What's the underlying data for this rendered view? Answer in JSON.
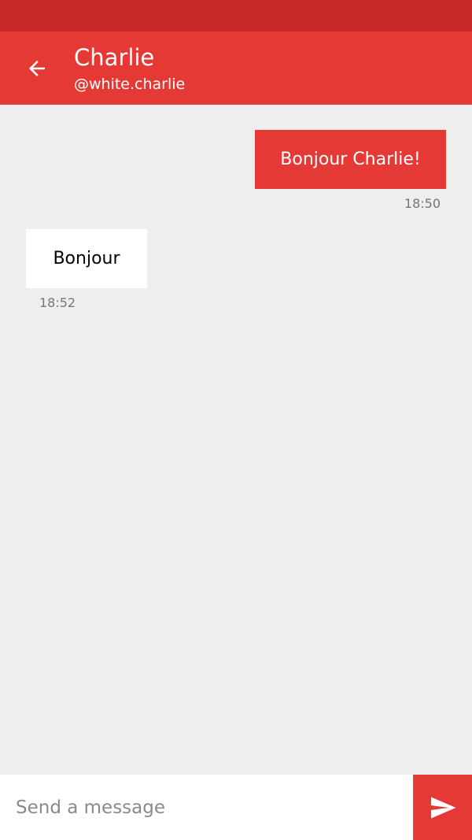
{
  "header": {
    "contact_name": "Charlie",
    "contact_handle": "@white.charlie",
    "back_icon": "arrow-back-icon"
  },
  "messages": [
    {
      "direction": "sent",
      "text": "Bonjour Charlie!",
      "time": "18:50"
    },
    {
      "direction": "received",
      "text": "Bonjour",
      "time": "18:52"
    }
  ],
  "composer": {
    "placeholder": "Send a message",
    "value": "",
    "send_icon": "send-icon"
  },
  "colors": {
    "primary": "#e53935",
    "primary_dark": "#c62828",
    "background": "#eeeeee",
    "received_bubble": "#ffffff",
    "timestamp": "#757575"
  }
}
